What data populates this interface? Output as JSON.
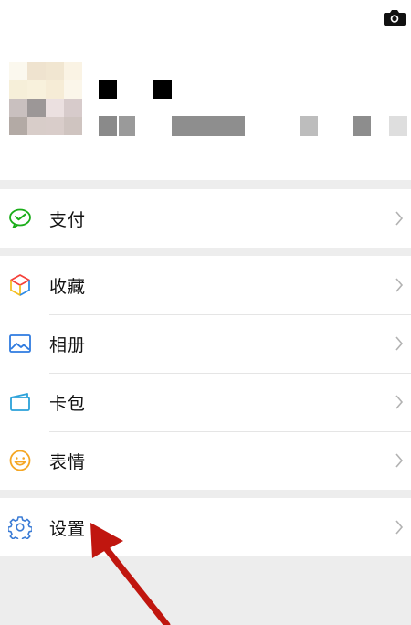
{
  "profile": {
    "camera_icon": "camera-icon"
  },
  "menu": {
    "pay": {
      "label": "支付",
      "icon": "wechat-pay-icon",
      "color": "#1aad19"
    },
    "favorites": {
      "label": "收藏",
      "icon": "favorites-cube-icon"
    },
    "album": {
      "label": "相册",
      "icon": "album-icon",
      "color": "#2f7be0"
    },
    "cards": {
      "label": "卡包",
      "icon": "card-wallet-icon",
      "color": "#2aa1d9"
    },
    "stickers": {
      "label": "表情",
      "icon": "smiley-icon",
      "color": "#f5a623"
    },
    "settings": {
      "label": "设置",
      "icon": "gear-icon",
      "color": "#3a7bd5"
    }
  },
  "annotation": {
    "arrow_color": "#c0160f"
  }
}
